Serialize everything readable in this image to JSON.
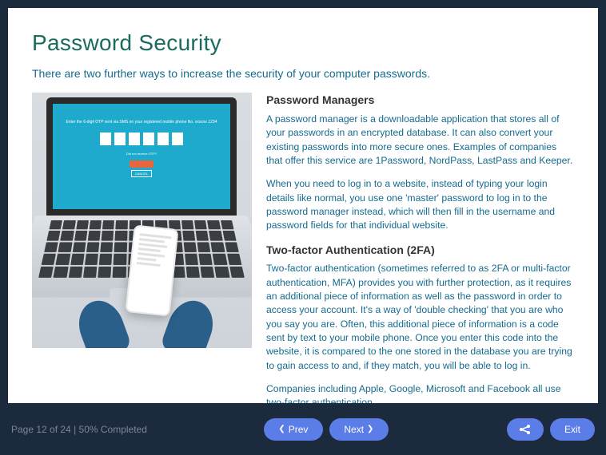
{
  "page": {
    "title": "Password Security",
    "intro": "There are two further ways to increase the security of your computer passwords."
  },
  "sections": {
    "pm": {
      "heading": "Password Managers",
      "p1": "A password manager is a downloadable application that stores all of your passwords in an encrypted database. It can also convert your existing passwords into more secure ones. Examples of companies that offer this service are 1Password, NordPass, LastPass and Keeper.",
      "p2": "When you need to log in to a website, instead of typing your login details like normal, you use one 'master' password to log in to the password manager instead, which will then fill in the username and password fields for that individual website."
    },
    "tfa": {
      "heading": "Two-factor Authentication (2FA)",
      "p1": "Two-factor authentication (sometimes referred to as 2FA or multi-factor authentication, MFA) provides you with further protection, as it requires an additional piece of information as well as the password in order to access your account. It's a way of 'double checking' that you are who you say you are. Often, this additional piece of information is a code sent by text to your mobile phone. Once you enter this code into the website, it is compared to the one stored in the database you are trying to gain access to and, if they match, you will be able to log in.",
      "p2": "Companies including Apple, Google, Microsoft and Facebook all use two-factor authentication."
    }
  },
  "footer": {
    "status": "Page 12 of 24 | 50% Completed",
    "prev": "Prev",
    "next": "Next",
    "exit": "Exit"
  }
}
